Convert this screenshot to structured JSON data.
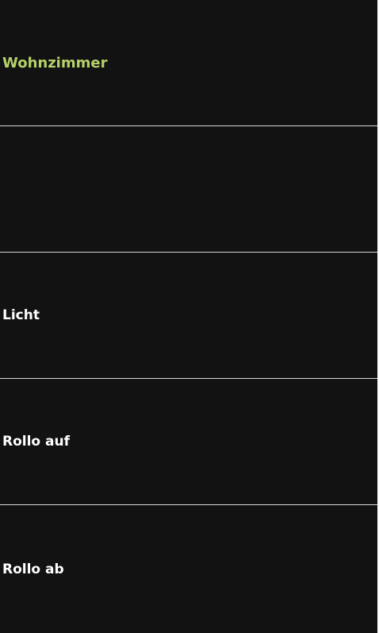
{
  "header": {
    "title": "Wohnzimmer",
    "title_color": "#b6d16a"
  },
  "rows": [
    {
      "label": ""
    },
    {
      "label": "Licht"
    },
    {
      "label": "Rollo auf"
    },
    {
      "label": "Rollo ab"
    }
  ],
  "colors": {
    "background": "#121212",
    "divider": "#d9d9d9",
    "text": "#ffffff"
  }
}
